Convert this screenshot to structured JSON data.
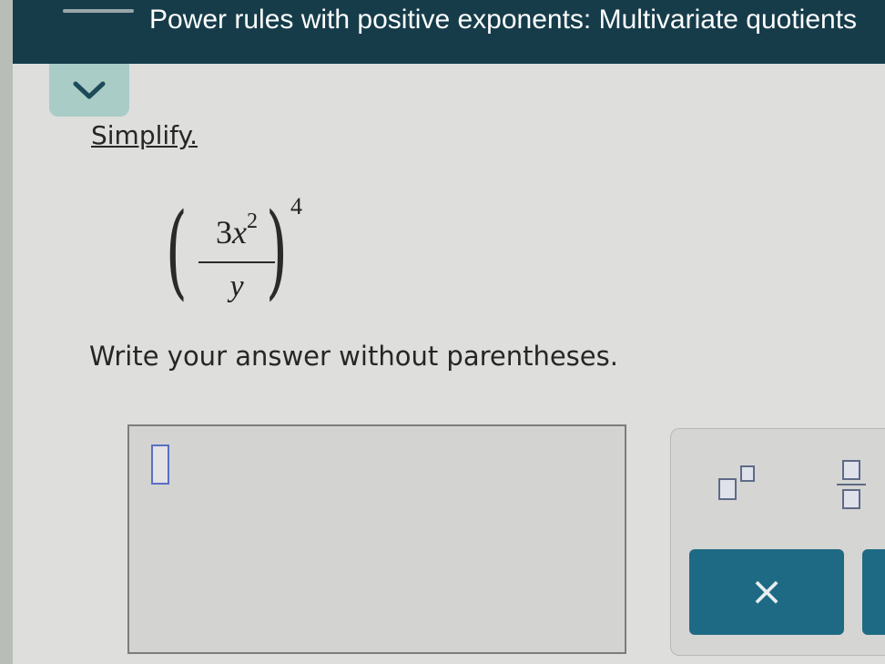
{
  "header": {
    "title": "Power rules with positive exponents: Multivariate quotients"
  },
  "problem": {
    "prompt": "Simplify",
    "prompt_period": ".",
    "expression": {
      "coefficient": "3",
      "variable": "x",
      "inner_exponent": "2",
      "denominator": "y",
      "outer_exponent": "4",
      "open_paren": "(",
      "close_paren": ")"
    },
    "instruction": "Write your answer without parentheses."
  },
  "palette": {
    "clear_symbol": "×"
  },
  "icons": {
    "toggle": "chevron-down-icon",
    "exponent": "exponent-template-icon",
    "fraction": "fraction-template-icon"
  },
  "colors": {
    "header_bg": "#163c4a",
    "toggle_bg": "#a9ccc7",
    "button_bg": "#1e6a84",
    "cursor_border": "#5b6fc7"
  }
}
